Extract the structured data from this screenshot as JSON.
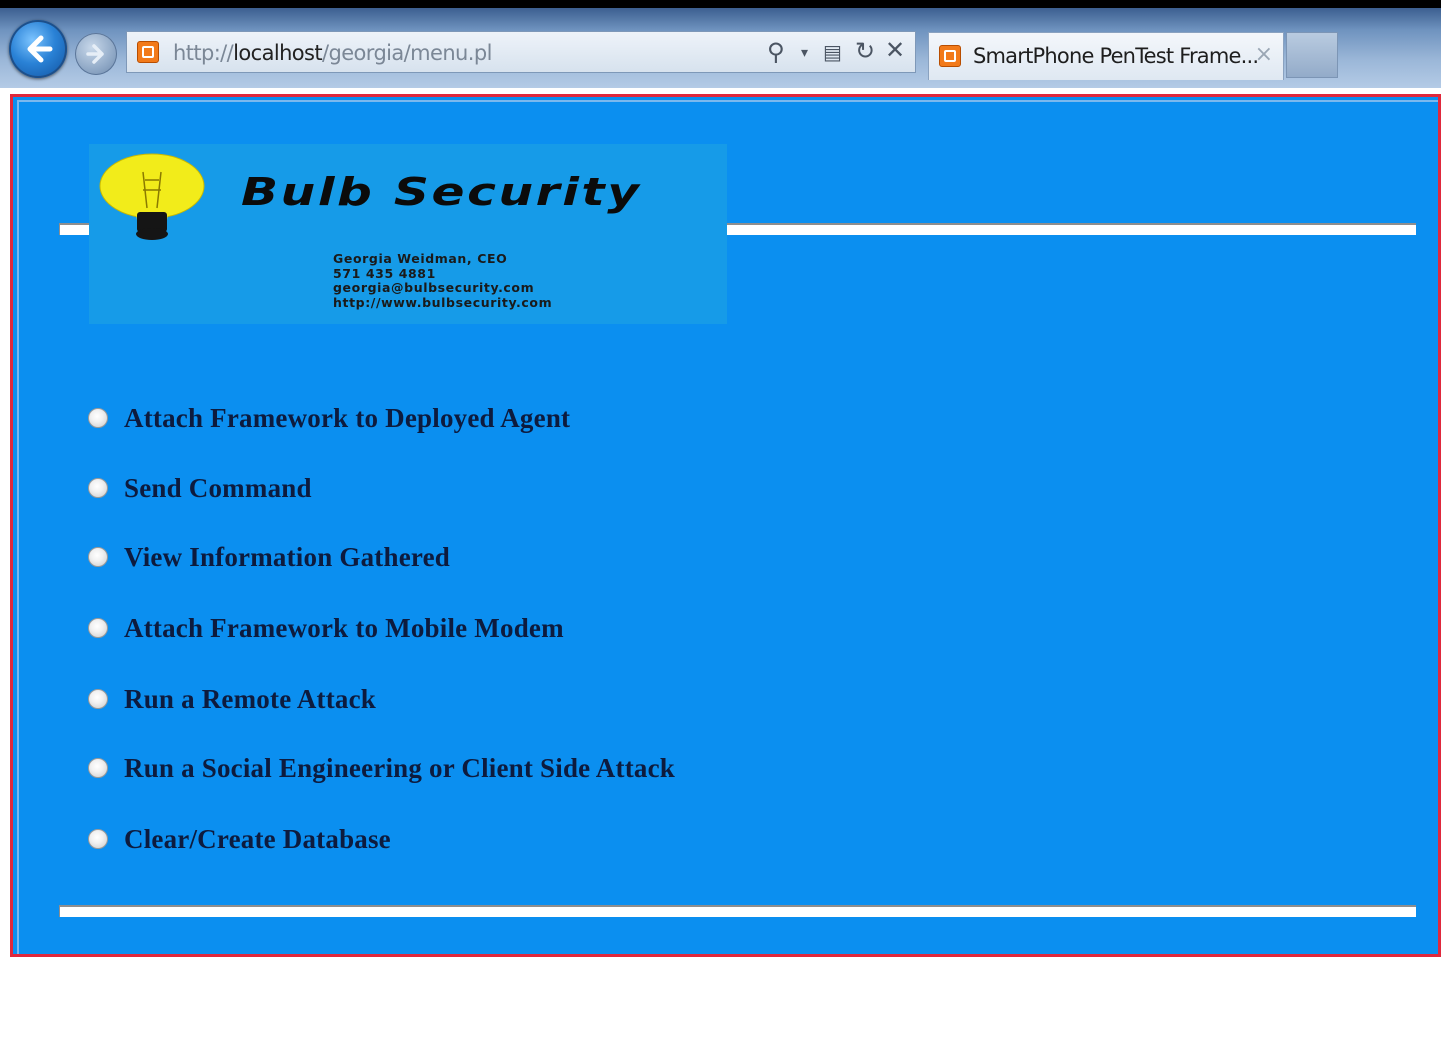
{
  "browser": {
    "url_prefix": "http://",
    "url_host": "localhost",
    "url_path": "/georgia/menu.pl",
    "tab_title": "SmartPhone PenTest Frame...",
    "tab_close": "×",
    "icons": {
      "back": "back-arrow-icon",
      "forward": "forward-arrow-icon",
      "search": "search-icon",
      "dropdown": "dropdown-arrow-icon",
      "compat": "compatibility-view-icon",
      "refresh": "refresh-icon",
      "stop": "stop-icon"
    }
  },
  "page": {
    "background_color": "#0b8ff0",
    "frame_border_color": "#e0283c",
    "logo": {
      "title": "Bulb Security",
      "card_line_1": "Georgia Weidman, CEO",
      "card_line_2": "571 435 4881",
      "card_line_3": "georgia@bulbsecurity.com",
      "card_line_4": "http://www.bulbsecurity.com"
    },
    "menu": [
      {
        "label": "Attach Framework to Deployed Agent",
        "selected": false
      },
      {
        "label": "Send Command",
        "selected": false
      },
      {
        "label": "View Information Gathered",
        "selected": false
      },
      {
        "label": "Attach Framework to Mobile Modem",
        "selected": false
      },
      {
        "label": "Run a Remote Attack",
        "selected": false
      },
      {
        "label": "Run a Social Engineering or Client Side Attack",
        "selected": false
      },
      {
        "label": "Clear/Create Database",
        "selected": false
      }
    ]
  }
}
